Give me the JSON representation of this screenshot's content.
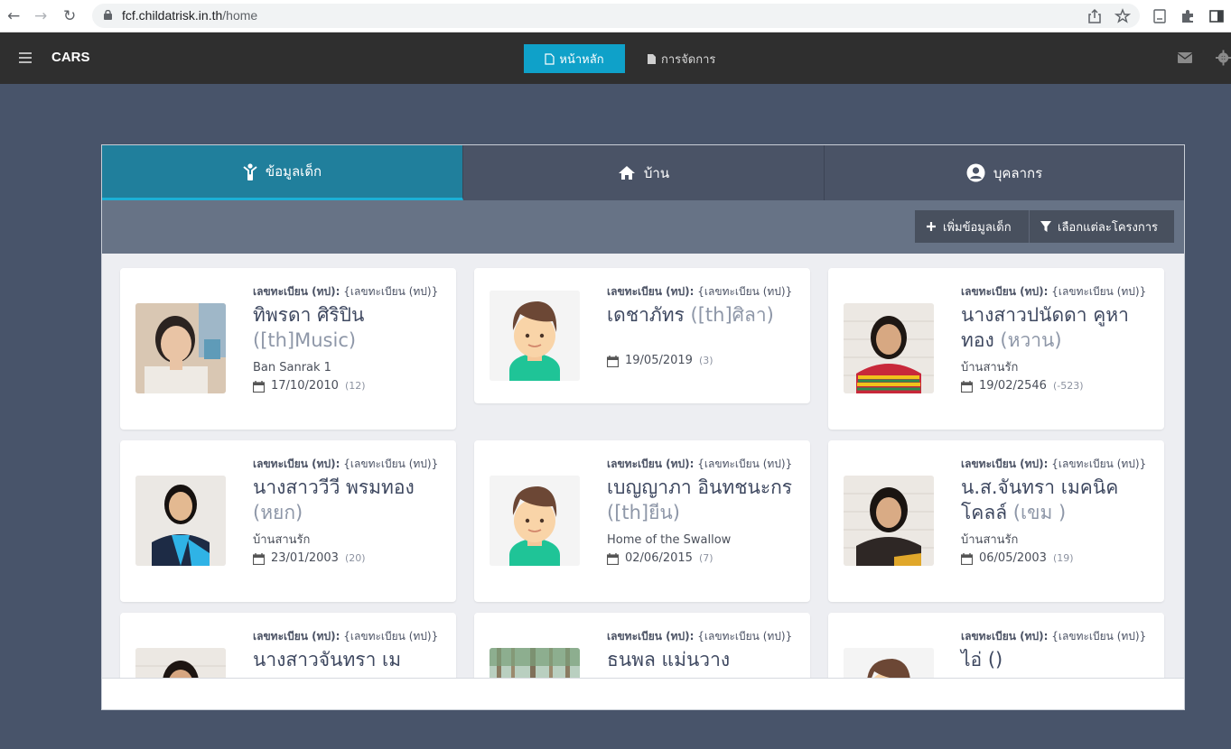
{
  "browser": {
    "url_host": "fcf.childatrisk.in.th",
    "url_path": "/home"
  },
  "navbar": {
    "brand": "CARS",
    "home_label": "หน้าหลัก",
    "manage_label": "การจัดการ"
  },
  "tabs": [
    {
      "label": "ข้อมูลเด็ก",
      "icon": "child-icon",
      "active": true
    },
    {
      "label": "บ้าน",
      "icon": "home-icon",
      "active": false
    },
    {
      "label": "บุคลากร",
      "icon": "user-circle-icon",
      "active": false
    }
  ],
  "toolbar": {
    "add_label": "เพิ่มข้อมูลเด็ก",
    "filter_label": "เลือกแต่ละโครงการ"
  },
  "children": [
    {
      "reg_label": "เลขทะเบียน (ทป):",
      "reg_value": "{เลขทะเบียน (ทป)}",
      "name": "ทิพรดา ศิริปิน",
      "nickname": "([th]Music)",
      "home": "Ban Sanrak 1",
      "dob": "17/10/2010",
      "age": "(12)",
      "photo": "photo"
    },
    {
      "reg_label": "เลขทะเบียน (ทป):",
      "reg_value": "{เลขทะเบียน (ทป)}",
      "name": "เดชาภัทร",
      "nickname": "([th]ศิลา)",
      "home": "",
      "dob": "19/05/2019",
      "age": "(3)",
      "photo": "avatar"
    },
    {
      "reg_label": "เลขทะเบียน (ทป):",
      "reg_value": "{เลขทะเบียน (ทป)}",
      "name": "นางสาวปนัดดา คูหาทอง",
      "nickname": "(หวาน)",
      "home": "บ้านสานรัก",
      "dob": "19/02/2546",
      "age": "(-523)",
      "photo": "photo"
    },
    {
      "reg_label": "เลขทะเบียน (ทป):",
      "reg_value": "{เลขทะเบียน (ทป)}",
      "name": "นางสาววีวี พรมทอง",
      "nickname": "(หยก)",
      "home": "บ้านสานรัก",
      "dob": "23/01/2003",
      "age": "(20)",
      "photo": "photo"
    },
    {
      "reg_label": "เลขทะเบียน (ทป):",
      "reg_value": "{เลขทะเบียน (ทป)}",
      "name": "เบญญาภา อินทชนะกร",
      "nickname": "([th]ยีน)",
      "home": "Home of the Swallow",
      "dob": "02/06/2015",
      "age": "(7)",
      "photo": "avatar"
    },
    {
      "reg_label": "เลขทะเบียน (ทป):",
      "reg_value": "{เลขทะเบียน (ทป)}",
      "name": "น.ส.จันทรา เมคนิคโคลล์",
      "nickname": "(เขม )",
      "home": "บ้านสานรัก",
      "dob": "06/05/2003",
      "age": "(19)",
      "photo": "photo"
    },
    {
      "reg_label": "เลขทะเบียน (ทป):",
      "reg_value": "{เลขทะเบียน (ทป)}",
      "name": "นางสาวจันทรา เม",
      "nickname": "",
      "home": "",
      "dob": "",
      "age": "",
      "photo": "photo"
    },
    {
      "reg_label": "เลขทะเบียน (ทป):",
      "reg_value": "{เลขทะเบียน (ทป)}",
      "name": "ธนพล แม่นวาง",
      "nickname": "",
      "home": "",
      "dob": "",
      "age": "",
      "photo": "forest"
    },
    {
      "reg_label": "เลขทะเบียน (ทป):",
      "reg_value": "{เลขทะเบียน (ทป)}",
      "name": "ไอ่ ()",
      "nickname": "",
      "home": "",
      "dob": "",
      "age": "",
      "photo": "avatar"
    }
  ],
  "colors": {
    "navbar_bg": "#2f2f2f",
    "accent": "#0fa1c9",
    "active_tab": "#207f9c",
    "page_bg": "#48546a"
  }
}
